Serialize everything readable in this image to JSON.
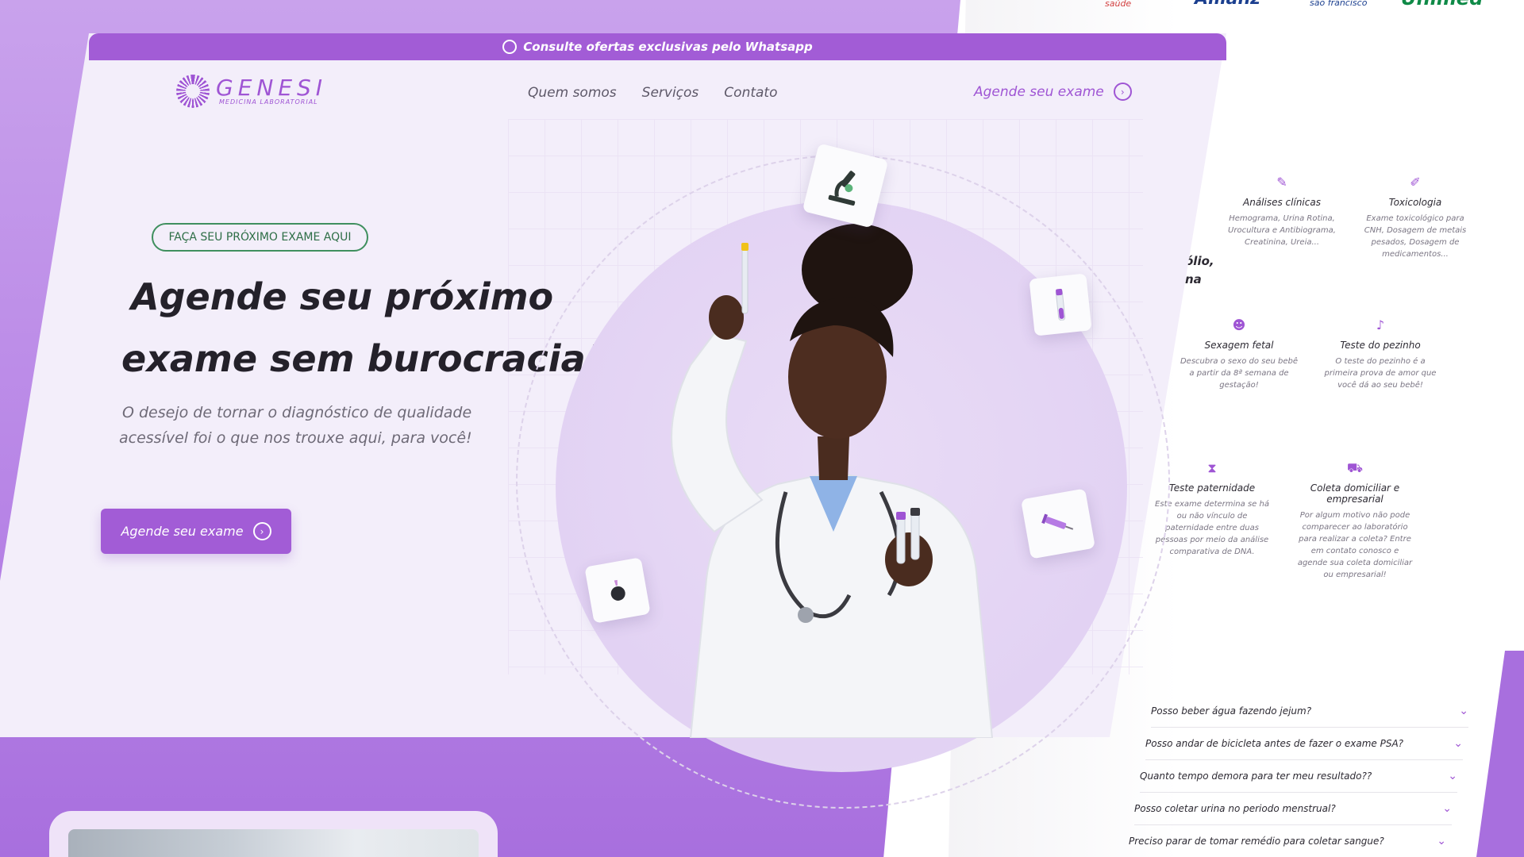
{
  "topbar": {
    "text": "Consulte ofertas exclusivas pelo Whatsapp"
  },
  "logo": {
    "name": "GENESI",
    "subtitle": "MEDICINA LABORATORIAL"
  },
  "nav": {
    "items": [
      "Quem somos",
      "Serviços",
      "Contato"
    ]
  },
  "header_cta": {
    "label": "Agende seu exame"
  },
  "hero": {
    "tag": "FAÇA SEU PRÓXIMO EXAME AQUI",
    "headline_line1": "Agende seu próximo",
    "headline_line2": "exame sem burocracia!",
    "subtitle_line1": "O desejo de tornar o diagnóstico de qualidade",
    "subtitle_line2": "acessível foi o que nos trouxe aqui, para você!",
    "cta": "Agende seu exame"
  },
  "partners": [
    "saúde",
    "Allianz",
    "são francisco",
    "Unimed"
  ],
  "right_panel": {
    "cut_text_1": "ólio,",
    "cut_text_2": "na",
    "services": [
      {
        "icon": "microscope-icon",
        "title": "Análises clínicas",
        "desc": "Hemograma, Urina Rotina, Urocultura e Antibiograma, Creatinina, Ureia..."
      },
      {
        "icon": "pipette-icon",
        "title": "Toxicologia",
        "desc": "Exame toxicológico para CNH, Dosagem de metais pesados, Dosagem de medicamentos..."
      },
      {
        "icon": "baby-icon",
        "title": "Sexagem fetal",
        "desc": "Descubra o sexo do seu bebê a partir da 8ª semana de gestação!"
      },
      {
        "icon": "foot-icon",
        "title": "Teste do pezinho",
        "desc": "O teste do pezinho é a primeira prova de amor que você dá ao seu bebê!"
      },
      {
        "icon": "dna-icon",
        "title": "Teste paternidade",
        "desc": "Este exame determina se há ou não vínculo de paternidade entre duas pessoas por meio da análise comparativa de DNA."
      },
      {
        "icon": "van-icon",
        "title": "Coleta domiciliar e empresarial",
        "desc": "Por algum motivo não pode comparecer ao laboratório para realizar a coleta? Entre em contato conosco e agende sua coleta domiciliar ou empresarial!"
      }
    ],
    "faq": [
      "Posso beber água fazendo jejum?",
      "Posso andar de bicicleta antes de fazer o exame PSA?",
      "Quanto tempo demora para ter meu resultado??",
      "Posso coletar urina no periodo menstrual?",
      "Preciso parar de tomar remédio para coletar sangue?"
    ]
  },
  "colors": {
    "brand_purple": "#a25cd6",
    "tag_green": "#3f8f5e",
    "hero_bg": "#f3eefa"
  }
}
